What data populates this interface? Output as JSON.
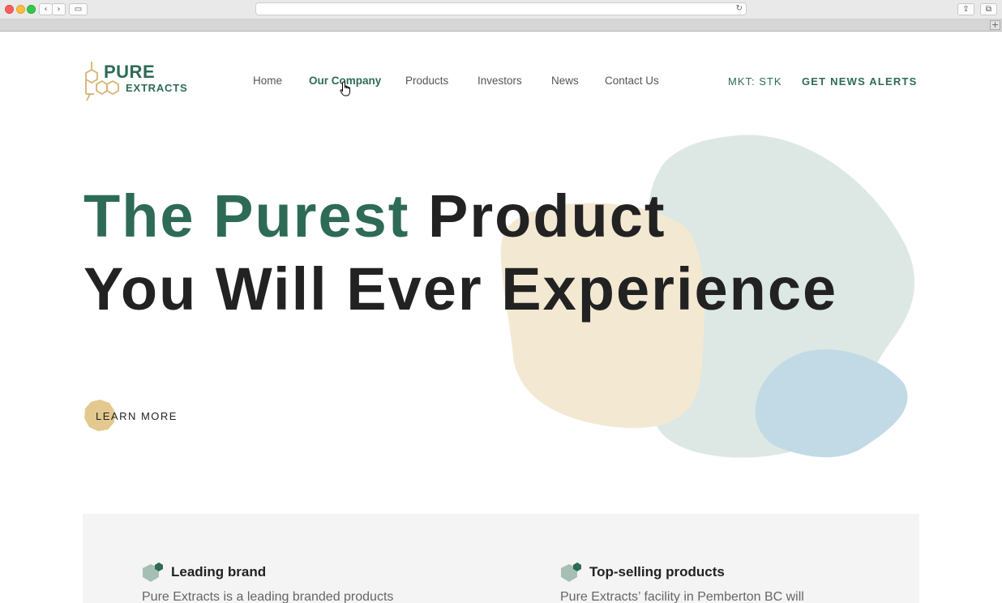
{
  "browser": {
    "back_glyph": "‹",
    "forward_glyph": "›",
    "sidebar_glyph": "▭",
    "reload_glyph": "↻",
    "share_glyph": "⇪",
    "tabs_glyph": "⧉",
    "newtab_glyph": "+"
  },
  "brand": {
    "word1": "PURE",
    "word2": "EXTRACTS",
    "primary_color": "#2e6b56",
    "gold_color": "#d4b373"
  },
  "nav": {
    "items": [
      {
        "label": "Home"
      },
      {
        "label": "Our Company",
        "active": true
      },
      {
        "label": "Products"
      },
      {
        "label": "Investors"
      },
      {
        "label": "News"
      },
      {
        "label": "Contact Us"
      }
    ],
    "market": "MKT: STK",
    "alerts": "GET NEWS ALERTS"
  },
  "hero": {
    "line1_green": "The Purest",
    "line1_rest": " Product",
    "line2": "You Will Ever Experience",
    "cta": "LEARN MORE",
    "blob_colors": [
      "#dde8e4",
      "#f3e8d2",
      "#c2dae5"
    ]
  },
  "features": [
    {
      "title": "Leading brand",
      "text": "Pure Extracts is a leading branded products",
      "icon": "hexagon-icon"
    },
    {
      "title": "Top-selling products",
      "text": "Pure Extracts’ facility in Pemberton BC will",
      "icon": "hexagon-icon"
    }
  ]
}
